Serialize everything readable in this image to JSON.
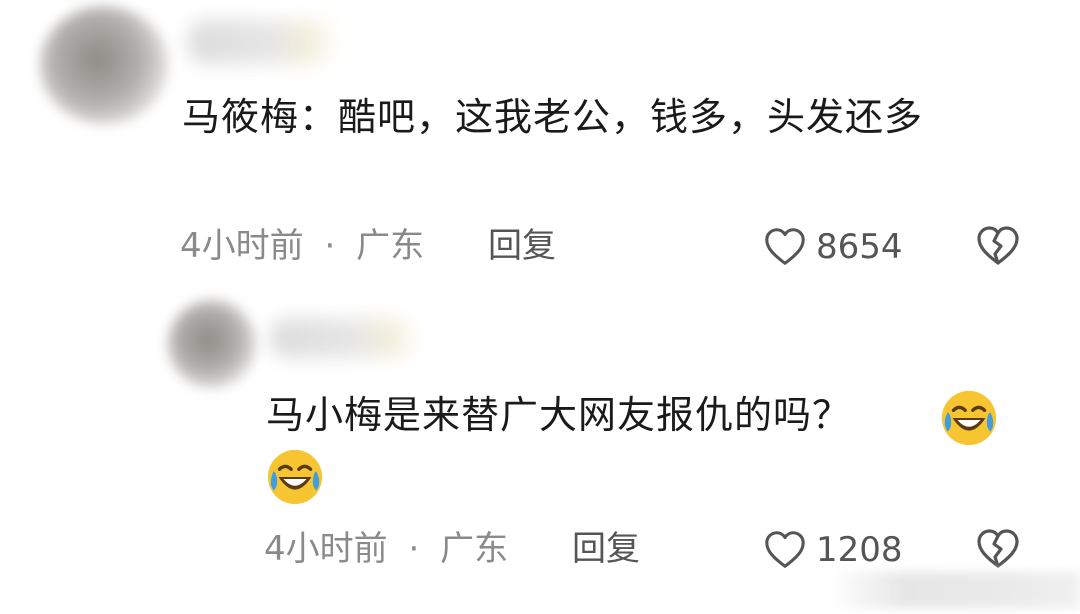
{
  "comments": [
    {
      "text": "马筱梅：酷吧，这我老公，钱多，头发还多",
      "time": "4小时前",
      "separator": "·",
      "location": "广东",
      "reply_label": "回复",
      "like_count": "8654",
      "emojis": []
    },
    {
      "text": "马小梅是来替广大网友报仇的吗？",
      "time": "4小时前",
      "separator": "·",
      "location": "广东",
      "reply_label": "回复",
      "like_count": "1208",
      "emojis": [
        "laughing-crying-emoji",
        "laughing-crying-emoji"
      ]
    }
  ],
  "icons": {
    "like": "heart-outline-icon",
    "dislike": "broken-heart-icon"
  },
  "colors": {
    "text": "#1a1a1a",
    "meta": "#8a8a8a",
    "emoji_face": "#f7c531"
  }
}
